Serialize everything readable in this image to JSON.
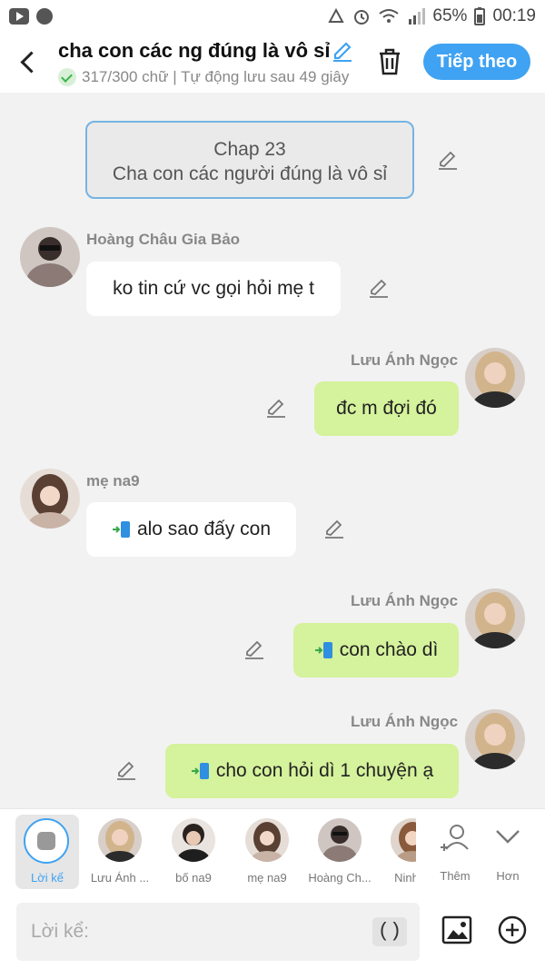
{
  "status_bar": {
    "battery": "65%",
    "time": "00:19"
  },
  "header": {
    "title": "cha con các ng đúng là vô sỉ",
    "subtitle": "317/300 chữ | Tự động lưu sau 49 giây",
    "next_label": "Tiếp theo"
  },
  "chapter": {
    "line1": "Chap 23",
    "line2": "Cha con các người đúng là vô sỉ"
  },
  "messages": [
    {
      "sender": "Hoàng Châu Gia Bảo",
      "text": "ko tin cứ vc gọi hỏi mẹ t",
      "side": "left"
    },
    {
      "sender": "Lưu Ánh Ngọc",
      "text": "đc m đợi đó",
      "side": "right"
    },
    {
      "sender": "mẹ na9",
      "text": "alo sao đấy con",
      "side": "left"
    },
    {
      "sender": "Lưu Ánh Ngọc",
      "text": "con chào dì",
      "side": "right"
    },
    {
      "sender": "Lưu Ánh Ngọc",
      "text": "cho con hỏi dì 1 chuyện ạ",
      "side": "right"
    }
  ],
  "characters": [
    {
      "label": "Lời kể"
    },
    {
      "label": "Lưu Ánh ..."
    },
    {
      "label": "bố na9"
    },
    {
      "label": "mẹ na9"
    },
    {
      "label": "Hoàng Ch..."
    },
    {
      "label": "Ninh N"
    },
    {
      "label": "Thêm"
    },
    {
      "label": "Hơn"
    }
  ],
  "input": {
    "placeholder": "Lời kể:",
    "paren": "()"
  },
  "colors": {
    "accent": "#3fa2f2",
    "bubble_right": "#d5f29c",
    "bubble_left": "#ffffff"
  }
}
